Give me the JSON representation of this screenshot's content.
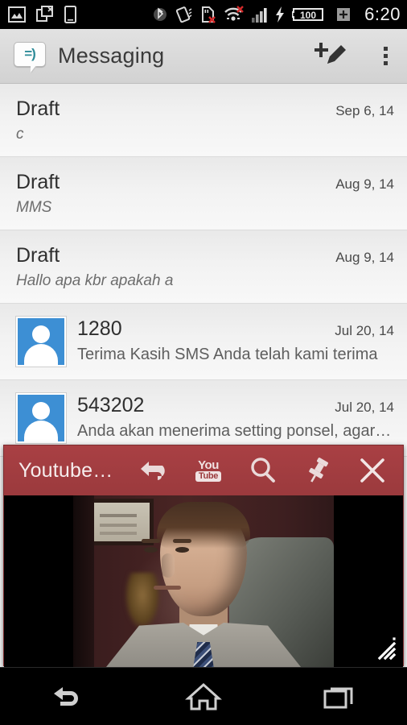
{
  "statusbar": {
    "time": "6:20",
    "left_icons": [
      "screenshot-icon",
      "copy-failed-icon",
      "device-icon"
    ],
    "right_icons": [
      "bluetooth-icon",
      "rotation-lock-icon",
      "sd-card-error-icon",
      "wifi-error-icon",
      "signal-bars-icon",
      "charging-bolt-icon"
    ],
    "battery_level": "100",
    "battery_plus": "+"
  },
  "appbar": {
    "icon": "messaging-smiley-icon",
    "smiley": "=)",
    "title": "Messaging",
    "new_message_icon": "new-message-pencil-icon",
    "overflow_icon": "overflow-menu-icon"
  },
  "threads": [
    {
      "title": "Draft",
      "preview": "c",
      "date": "Sep 6, 14",
      "has_avatar": false,
      "italic": true
    },
    {
      "title": "Draft",
      "preview": "MMS",
      "date": "Aug 9, 14",
      "has_avatar": false,
      "italic": true
    },
    {
      "title": "Draft",
      "preview": "Hallo apa kbr apakah a",
      "date": "Aug 9, 14",
      "has_avatar": false,
      "italic": true
    },
    {
      "title": "1280",
      "preview": "Terima Kasih SMS Anda telah kami terima",
      "date": "Jul 20, 14",
      "has_avatar": true,
      "italic": false
    },
    {
      "title": "543202",
      "preview": "Anda akan menerima setting ponsel, agar…",
      "date": "Jul 20, 14",
      "has_avatar": true,
      "italic": false
    }
  ],
  "floating_window": {
    "title": "Youtube…",
    "accent_color": "#9b3a3d",
    "actions": [
      {
        "name": "back-icon",
        "label": "Back"
      },
      {
        "name": "youtube-logo-icon",
        "label": "YouTube"
      },
      {
        "name": "search-icon",
        "label": "Search"
      },
      {
        "name": "pin-icon",
        "label": "Pin"
      },
      {
        "name": "close-icon",
        "label": "Close"
      }
    ],
    "youtube_logo": {
      "top": "You",
      "bottom": "Tube"
    },
    "resize_handle": "resize-handle-icon"
  },
  "navbar": {
    "buttons": [
      {
        "name": "nav-back-button",
        "icon": "back-arrow-icon"
      },
      {
        "name": "nav-home-button",
        "icon": "home-icon"
      },
      {
        "name": "nav-recents-button",
        "icon": "recents-icon"
      }
    ]
  }
}
